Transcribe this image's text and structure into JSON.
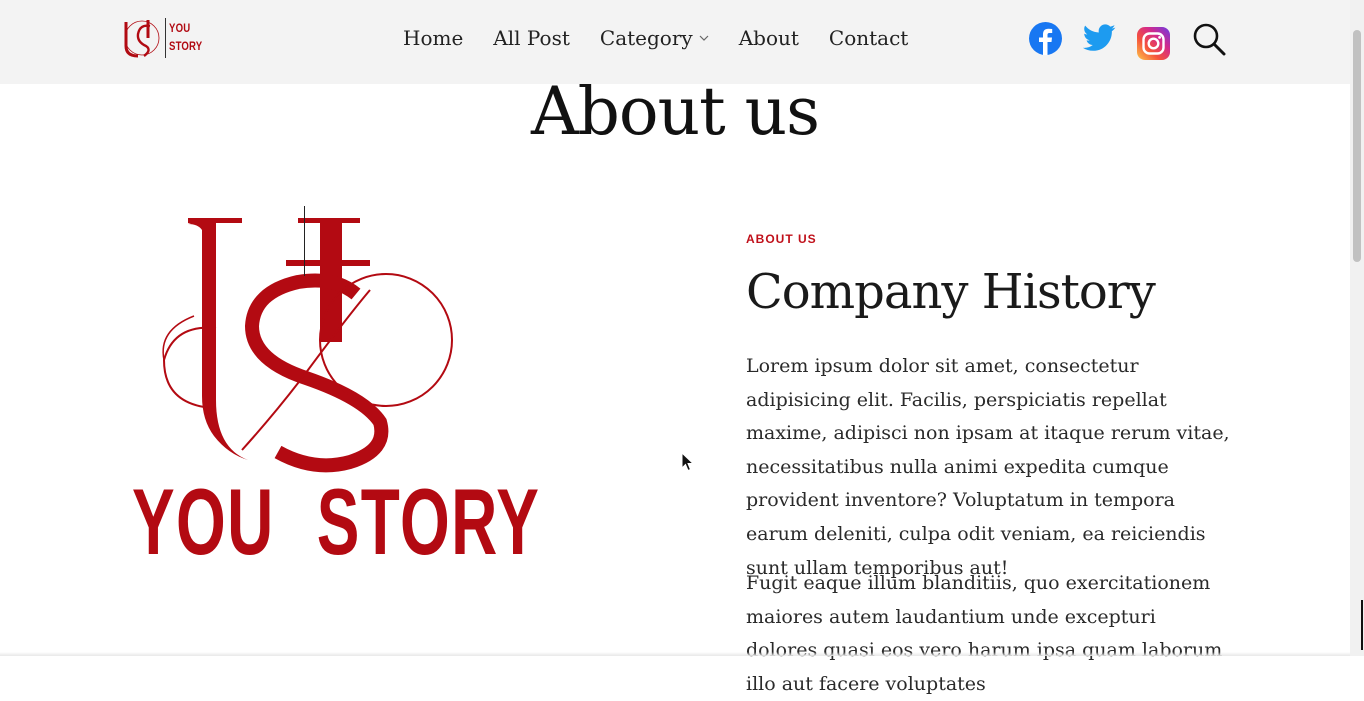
{
  "header": {
    "logo": {
      "line1": "YOU",
      "line2": "STORY"
    },
    "nav": [
      {
        "label": "Home"
      },
      {
        "label": "All Post"
      },
      {
        "label": "Category"
      },
      {
        "label": "About"
      },
      {
        "label": "Contact"
      }
    ],
    "icons": [
      "facebook-icon",
      "twitter-icon",
      "instagram-icon",
      "search-icon"
    ]
  },
  "page": {
    "title": "About us"
  },
  "brand": {
    "wordmark_left": "YOU",
    "wordmark_right": "STORY",
    "color": "#b30a12"
  },
  "about": {
    "eyebrow": "ABOUT US",
    "title": "Company History",
    "paragraph1": "Lorem ipsum dolor sit amet, consectetur adipisicing elit. Facilis, perspiciatis repellat maxime, adipisci non ipsam at itaque rerum vitae, necessitatibus nulla animi expedita cumque provident inventore? Voluptatum in tempora earum deleniti, culpa odit veniam, ea reiciendis sunt ullam temporibus aut!",
    "paragraph2": "Fugit eaque illum blanditiis, quo exercitationem maiores autem laudantium unde excepturi dolores quasi eos vero harum ipsa quam laborum illo aut facere voluptates"
  },
  "colors": {
    "accent": "#c0101a",
    "facebook": "#1877f2",
    "twitter": "#1d9bf0",
    "header_bg": "#f3f3f3"
  }
}
